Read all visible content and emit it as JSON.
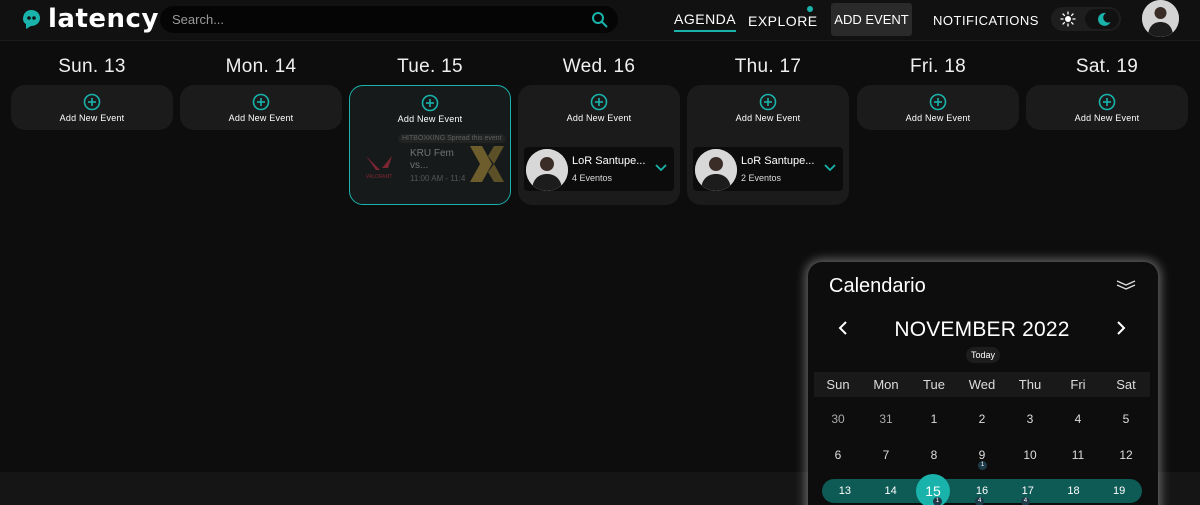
{
  "header": {
    "brand": "latency",
    "search_placeholder": "Search...",
    "nav": {
      "agenda": "AGENDA",
      "explore": "EXPLORE",
      "add_event": "ADD EVENT",
      "notifications": "NOTIFICATIONS"
    },
    "theme": "dark"
  },
  "colors": {
    "accent": "#19b3ab",
    "background": "#0d0d0d",
    "card": "#1b1b1b"
  },
  "days": [
    {
      "label": "Sun. 13",
      "add_label": "Add New Event"
    },
    {
      "label": "Mon. 14",
      "add_label": "Add New Event"
    },
    {
      "label": "Tue. 15",
      "add_label": "Add New Event",
      "ghost_event": {
        "tag": "HITBOXKING Spread this event",
        "title_line1": "KRU Fem",
        "title_line2": "vs...",
        "time": "11:00 AM - 11:4",
        "game": "VALORANT"
      }
    },
    {
      "label": "Wed. 16",
      "add_label": "Add New Event",
      "event_group": {
        "title": "LoR Santupe...",
        "count": "4 Eventos"
      }
    },
    {
      "label": "Thu. 17",
      "add_label": "Add New Event",
      "event_group": {
        "title": "LoR Santupe...",
        "count": "2 Eventos"
      }
    },
    {
      "label": "Fri. 18",
      "add_label": "Add New Event"
    },
    {
      "label": "Sat. 19",
      "add_label": "Add New Event"
    }
  ],
  "calendar": {
    "title": "Calendario",
    "month": "NOVEMBER 2022",
    "today_label": "Today",
    "weekdays": [
      "Sun",
      "Mon",
      "Tue",
      "Wed",
      "Thu",
      "Fri",
      "Sat"
    ],
    "weeks": [
      [
        "30",
        "31",
        "1",
        "2",
        "3",
        "4",
        "5"
      ],
      [
        "6",
        "7",
        "8",
        "9",
        "10",
        "11",
        "12"
      ],
      [
        "13",
        "14",
        "15",
        "16",
        "17",
        "18",
        "19"
      ]
    ],
    "selected_day": "15",
    "badges": {
      "9": "1",
      "15": "1",
      "16": "4",
      "17": "4"
    }
  }
}
